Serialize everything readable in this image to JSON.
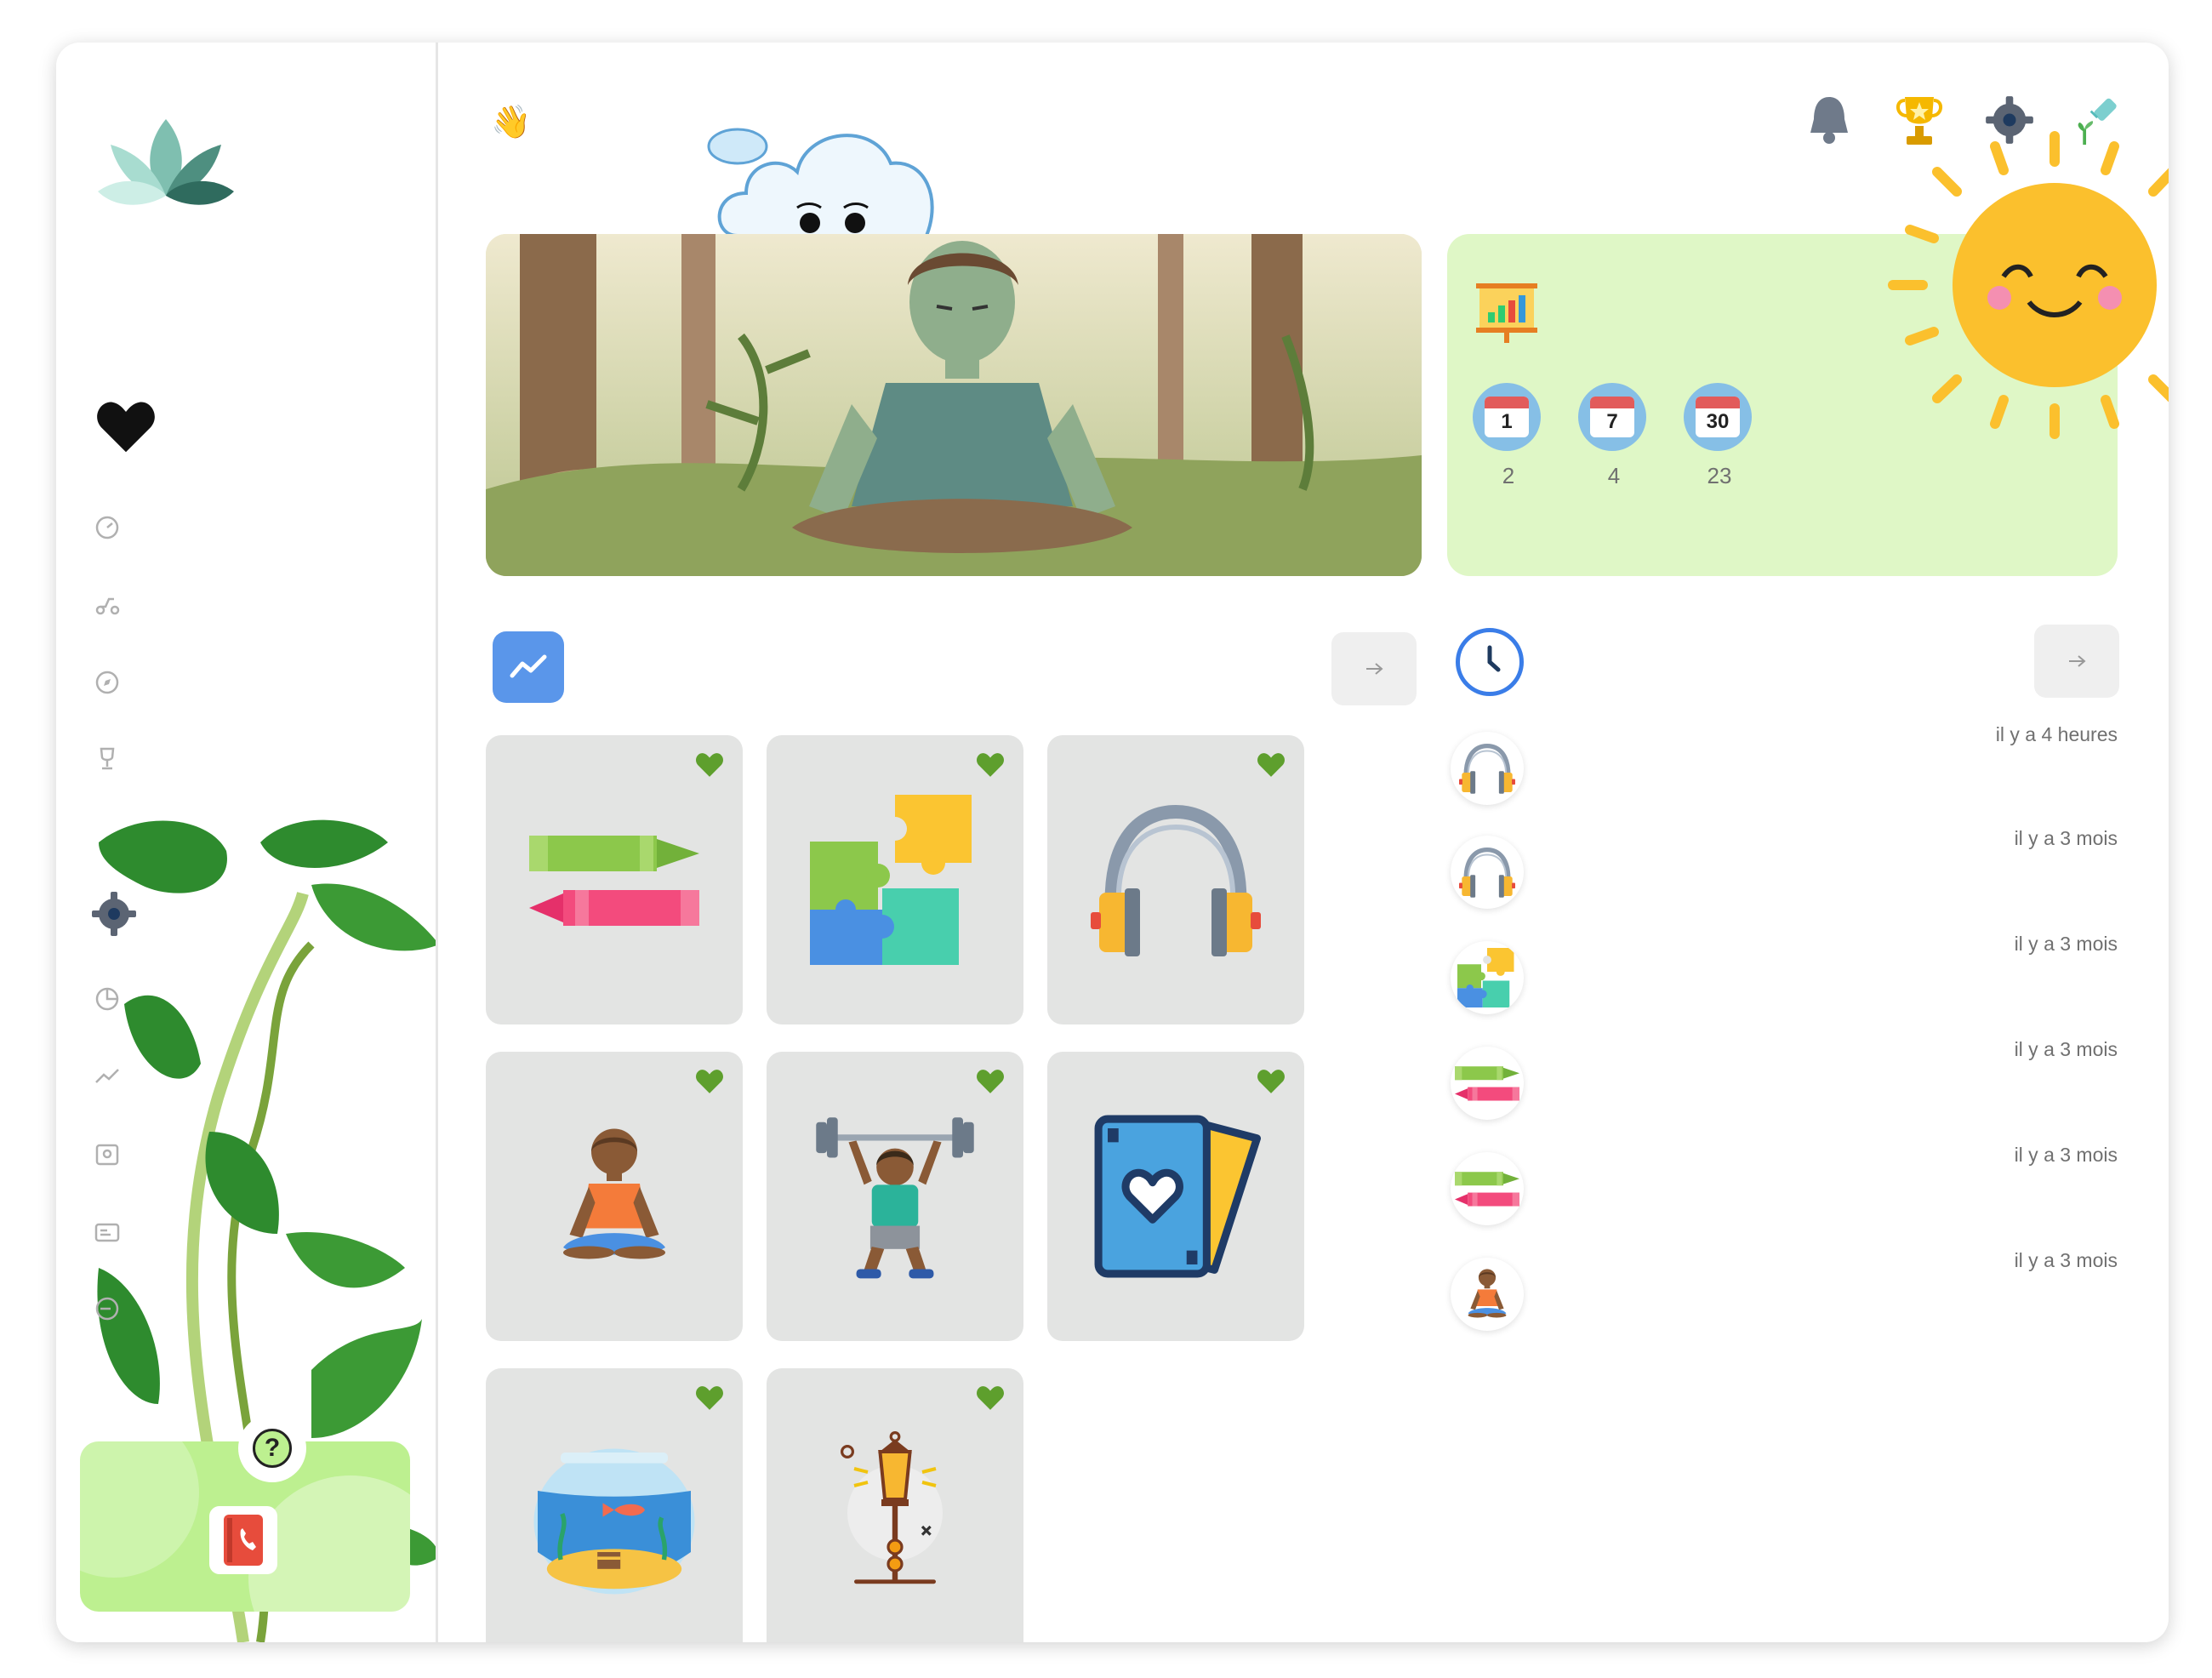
{
  "sidebar": {
    "nav_icons": [
      "speedometer-icon",
      "scooter-icon",
      "compass-icon",
      "trophy-outline-icon"
    ],
    "secondary_icons": [
      "gear-icon",
      "pie-chart-icon",
      "trend-icon",
      "calendar-contact-icon",
      "id-card-icon",
      "logout-icon"
    ],
    "help_symbol": "?"
  },
  "header": {
    "greeting_emoji": "👋"
  },
  "stats": {
    "items": [
      {
        "day": "1",
        "value": "2"
      },
      {
        "day": "7",
        "value": "4"
      },
      {
        "day": "30",
        "value": "23"
      }
    ]
  },
  "activities": [
    {
      "icon": "crayons-icon"
    },
    {
      "icon": "puzzle-icon"
    },
    {
      "icon": "headphones-icon"
    },
    {
      "icon": "meditation-icon"
    },
    {
      "icon": "weightlifter-icon"
    },
    {
      "icon": "heart-card-icon"
    },
    {
      "icon": "fishbowl-icon"
    },
    {
      "icon": "lantern-icon"
    }
  ],
  "recent": [
    {
      "icon": "headphones-icon",
      "time": "il y a 4 heures"
    },
    {
      "icon": "headphones-icon",
      "time": "il y a 3 mois"
    },
    {
      "icon": "puzzle-icon",
      "time": "il y a 3 mois"
    },
    {
      "icon": "crayons-icon",
      "time": "il y a 3 mois"
    },
    {
      "icon": "crayons-icon",
      "time": "il y a 3 mois"
    },
    {
      "icon": "meditation-icon",
      "time": "il y a 3 mois"
    }
  ],
  "colors": {
    "accent_blue": "#3a7de8",
    "stats_bg": "#dff7c6",
    "help_bg": "#bdf090",
    "heart_green": "#5e9f2d",
    "tile_bg": "#e3e4e3"
  }
}
